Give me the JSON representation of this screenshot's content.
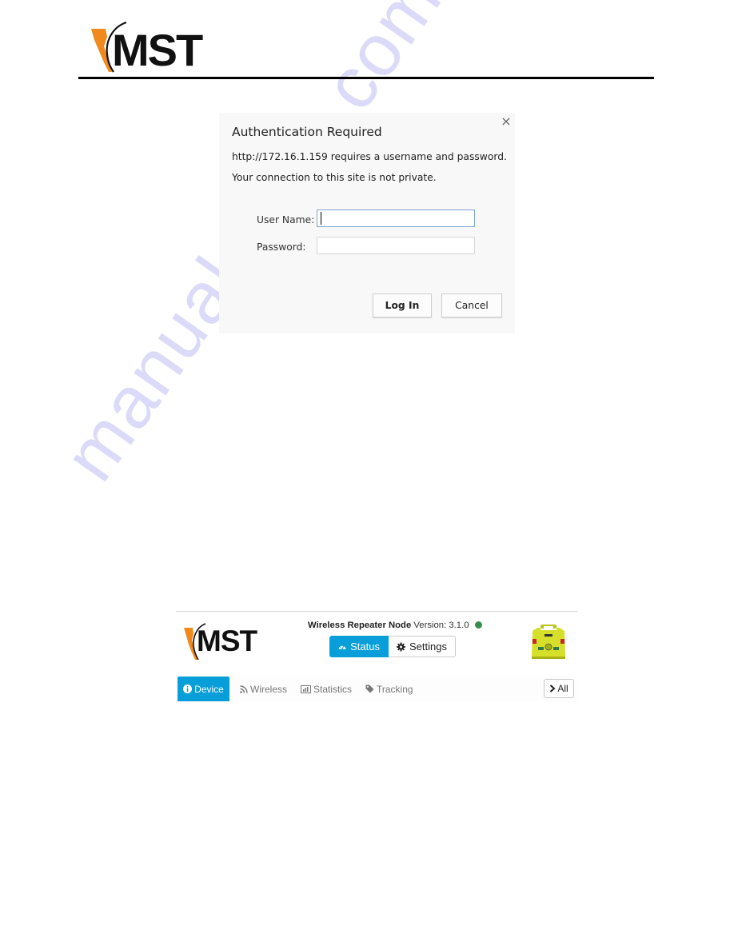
{
  "document": {
    "brand": "MST",
    "colors": {
      "brand_orange": "#f08a1c",
      "accent_blue": "#089ed9",
      "online_green": "#3a8c4c"
    }
  },
  "auth_dialog": {
    "title": "Authentication Required",
    "message": "http://172.16.1.159 requires a username and password.",
    "warning": "Your connection to this site is not private.",
    "username_label": "User Name:",
    "username_value": "",
    "password_label": "Password:",
    "password_value": "",
    "login_label": "Log In",
    "cancel_label": "Cancel",
    "close_icon": "×"
  },
  "web_interface": {
    "logo_text": "MST",
    "device_name": "Wireless Repeater Node",
    "version_label": "Version:",
    "version": "3.1.0",
    "status_indicator": "online",
    "mode_buttons": [
      {
        "label": "Status",
        "icon": "dashboard-icon",
        "active": true
      },
      {
        "label": "Settings",
        "icon": "gear-icon",
        "active": false
      }
    ],
    "tabs": [
      {
        "label": "Device",
        "icon": "info-icon",
        "active": true
      },
      {
        "label": "Wireless",
        "icon": "rss-icon",
        "active": false
      },
      {
        "label": "Statistics",
        "icon": "bar-chart-icon",
        "active": false
      },
      {
        "label": "Tracking",
        "icon": "tag-icon",
        "active": false
      }
    ],
    "all_button_label": "All"
  },
  "watermark": "manualshive.com"
}
